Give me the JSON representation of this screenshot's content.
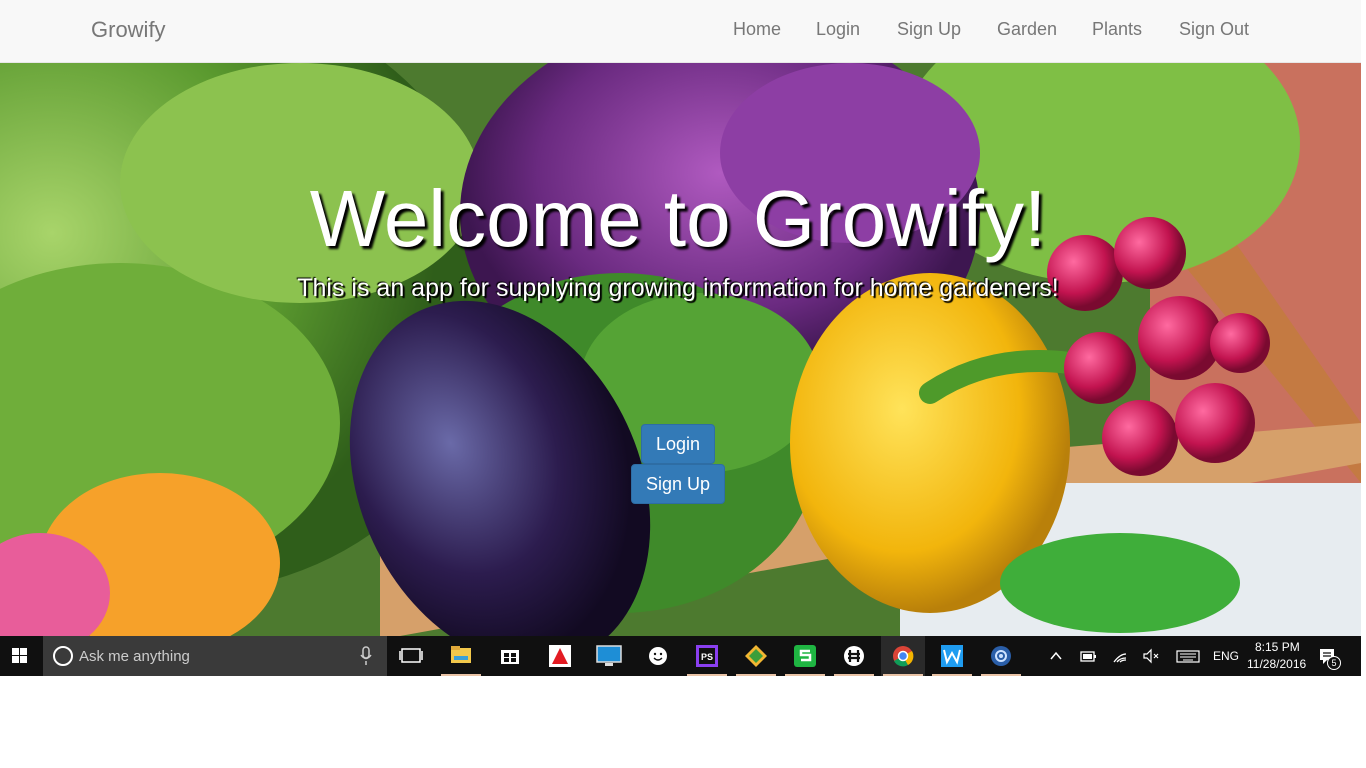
{
  "navbar": {
    "brand": "Growify",
    "links": [
      "Home",
      "Login",
      "Sign Up",
      "Garden",
      "Plants",
      "Sign Out"
    ]
  },
  "hero": {
    "title": "Welcome to Growify!",
    "subtitle": "This is an app for supplying growing information for home gardeners!",
    "login_label": "Login",
    "signup_label": "Sign Up"
  },
  "taskbar": {
    "search_placeholder": "Ask me anything",
    "language": "ENG",
    "time": "8:15 PM",
    "date": "11/28/2016",
    "notification_count": "5",
    "apps": [
      "file-explorer-icon",
      "store-icon",
      "adobe-icon",
      "monitor-icon",
      "emoji-app-icon",
      "phpstorm-icon",
      "gitkraken-icon",
      "spreadsheet-icon",
      "slack-icon",
      "chrome-icon",
      "webstorm-icon",
      "steam-icon"
    ]
  },
  "colors": {
    "navbar_bg": "#f8f8f8",
    "nav_text": "#777777",
    "button_primary": "#337ab7",
    "taskbar_bg": "#101010"
  }
}
